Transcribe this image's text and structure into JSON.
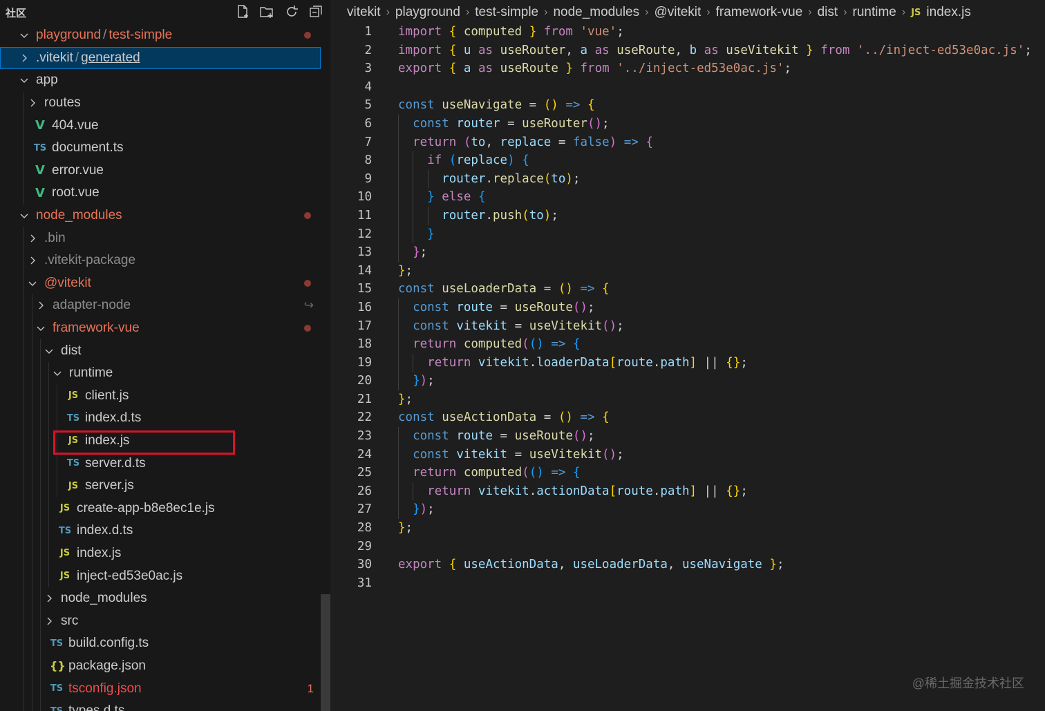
{
  "sidebar": {
    "title": "社区",
    "tree": [
      {
        "label": "playground",
        "label2": "test-simple",
        "kind": "folder",
        "open": true,
        "depth": 0,
        "color": "mod",
        "badge": "dot"
      },
      {
        "label": ".vitekit",
        "label2": "generated",
        "kind": "folder",
        "open": false,
        "depth": 0,
        "color": "normal",
        "selected": true
      },
      {
        "label": "app",
        "kind": "folder",
        "open": true,
        "depth": 0,
        "color": "normal"
      },
      {
        "label": "routes",
        "kind": "folder",
        "open": false,
        "depth": 1,
        "color": "normal"
      },
      {
        "label": "404.vue",
        "kind": "vue",
        "depth": 1,
        "color": "normal"
      },
      {
        "label": "document.ts",
        "kind": "ts",
        "depth": 1,
        "color": "normal"
      },
      {
        "label": "error.vue",
        "kind": "vue",
        "depth": 1,
        "color": "normal"
      },
      {
        "label": "root.vue",
        "kind": "vue",
        "depth": 1,
        "color": "normal"
      },
      {
        "label": "node_modules",
        "kind": "folder",
        "open": true,
        "depth": 0,
        "color": "mod",
        "badge": "dot"
      },
      {
        "label": ".bin",
        "kind": "folder",
        "open": false,
        "depth": 1,
        "color": "dim"
      },
      {
        "label": ".vitekit-package",
        "kind": "folder",
        "open": false,
        "depth": 1,
        "color": "dim"
      },
      {
        "label": "@vitekit",
        "kind": "folder",
        "open": true,
        "depth": 1,
        "color": "mod",
        "badge": "dot"
      },
      {
        "label": "adapter-node",
        "kind": "folder",
        "open": false,
        "depth": 2,
        "color": "dim",
        "badge": "link"
      },
      {
        "label": "framework-vue",
        "kind": "folder",
        "open": true,
        "depth": 2,
        "color": "mod",
        "badge": "dot"
      },
      {
        "label": "dist",
        "kind": "folder",
        "open": true,
        "depth": 3,
        "color": "normal"
      },
      {
        "label": "runtime",
        "kind": "folder",
        "open": true,
        "depth": 4,
        "color": "normal"
      },
      {
        "label": "client.js",
        "kind": "js",
        "depth": 5,
        "color": "normal"
      },
      {
        "label": "index.d.ts",
        "kind": "ts",
        "depth": 5,
        "color": "normal"
      },
      {
        "label": "index.js",
        "kind": "js",
        "depth": 5,
        "color": "normal",
        "highlighted": true
      },
      {
        "label": "server.d.ts",
        "kind": "ts",
        "depth": 5,
        "color": "normal"
      },
      {
        "label": "server.js",
        "kind": "js",
        "depth": 5,
        "color": "normal"
      },
      {
        "label": "create-app-b8e8ec1e.js",
        "kind": "js",
        "depth": 4,
        "color": "normal"
      },
      {
        "label": "index.d.ts",
        "kind": "ts",
        "depth": 4,
        "color": "normal"
      },
      {
        "label": "index.js",
        "kind": "js",
        "depth": 4,
        "color": "normal"
      },
      {
        "label": "inject-ed53e0ac.js",
        "kind": "js",
        "depth": 4,
        "color": "normal"
      },
      {
        "label": "node_modules",
        "kind": "folder",
        "open": false,
        "depth": 3,
        "color": "normal"
      },
      {
        "label": "src",
        "kind": "folder",
        "open": false,
        "depth": 3,
        "color": "normal"
      },
      {
        "label": "build.config.ts",
        "kind": "ts",
        "depth": 3,
        "color": "normal"
      },
      {
        "label": "package.json",
        "kind": "json",
        "depth": 3,
        "color": "normal"
      },
      {
        "label": "tsconfig.json",
        "kind": "tsconfig",
        "depth": 3,
        "color": "err",
        "badge": "1"
      },
      {
        "label": "types.d.ts",
        "kind": "ts",
        "depth": 3,
        "color": "normal"
      }
    ]
  },
  "breadcrumb": [
    "vitekit",
    "playground",
    "test-simple",
    "node_modules",
    "@vitekit",
    "framework-vue",
    "dist",
    "runtime",
    "index.js"
  ],
  "code": [
    {
      "n": "1",
      "tokens": [
        [
          "kc",
          "import"
        ],
        [
          "p",
          " "
        ],
        [
          "b1",
          "{"
        ],
        [
          "p",
          " "
        ],
        [
          "f",
          "computed"
        ],
        [
          "p",
          " "
        ],
        [
          "b1",
          "}"
        ],
        [
          "p",
          " "
        ],
        [
          "kc",
          "from"
        ],
        [
          "p",
          " "
        ],
        [
          "s",
          "'vue'"
        ],
        [
          "p",
          ";"
        ]
      ]
    },
    {
      "n": "2",
      "tokens": [
        [
          "kc",
          "import"
        ],
        [
          "p",
          " "
        ],
        [
          "b1",
          "{"
        ],
        [
          "p",
          " "
        ],
        [
          "v",
          "u"
        ],
        [
          "p",
          " "
        ],
        [
          "kc",
          "as"
        ],
        [
          "p",
          " "
        ],
        [
          "f",
          "useRouter"
        ],
        [
          "p",
          ", "
        ],
        [
          "v",
          "a"
        ],
        [
          "p",
          " "
        ],
        [
          "kc",
          "as"
        ],
        [
          "p",
          " "
        ],
        [
          "f",
          "useRoute"
        ],
        [
          "p",
          ", "
        ],
        [
          "v",
          "b"
        ],
        [
          "p",
          " "
        ],
        [
          "kc",
          "as"
        ],
        [
          "p",
          " "
        ],
        [
          "f",
          "useVitekit"
        ],
        [
          "p",
          " "
        ],
        [
          "b1",
          "}"
        ],
        [
          "p",
          " "
        ],
        [
          "kc",
          "from"
        ],
        [
          "p",
          " "
        ],
        [
          "s",
          "'../inject-ed53e0ac.js'"
        ],
        [
          "p",
          ";"
        ]
      ]
    },
    {
      "n": "3",
      "tokens": [
        [
          "kc",
          "export"
        ],
        [
          "p",
          " "
        ],
        [
          "b1",
          "{"
        ],
        [
          "p",
          " "
        ],
        [
          "v",
          "a"
        ],
        [
          "p",
          " "
        ],
        [
          "kc",
          "as"
        ],
        [
          "p",
          " "
        ],
        [
          "f",
          "useRoute"
        ],
        [
          "p",
          " "
        ],
        [
          "b1",
          "}"
        ],
        [
          "p",
          " "
        ],
        [
          "kc",
          "from"
        ],
        [
          "p",
          " "
        ],
        [
          "s",
          "'../inject-ed53e0ac.js'"
        ],
        [
          "p",
          ";"
        ]
      ]
    },
    {
      "n": "4",
      "tokens": []
    },
    {
      "n": "5",
      "tokens": [
        [
          "k",
          "const"
        ],
        [
          "p",
          " "
        ],
        [
          "f",
          "useNavigate"
        ],
        [
          "p",
          " = "
        ],
        [
          "b1",
          "()"
        ],
        [
          "p",
          " "
        ],
        [
          "k",
          "=>"
        ],
        [
          "p",
          " "
        ],
        [
          "b1",
          "{"
        ]
      ]
    },
    {
      "n": "6",
      "indent": 1,
      "tokens": [
        [
          "k",
          "const"
        ],
        [
          "p",
          " "
        ],
        [
          "v",
          "router"
        ],
        [
          "p",
          " = "
        ],
        [
          "f",
          "useRouter"
        ],
        [
          "b2",
          "()"
        ],
        [
          "p",
          ";"
        ]
      ]
    },
    {
      "n": "7",
      "indent": 1,
      "tokens": [
        [
          "kc",
          "return"
        ],
        [
          "p",
          " "
        ],
        [
          "b2",
          "("
        ],
        [
          "v",
          "to"
        ],
        [
          "p",
          ", "
        ],
        [
          "v",
          "replace"
        ],
        [
          "p",
          " = "
        ],
        [
          "k",
          "false"
        ],
        [
          "b2",
          ")"
        ],
        [
          "p",
          " "
        ],
        [
          "k",
          "=>"
        ],
        [
          "p",
          " "
        ],
        [
          "b2",
          "{"
        ]
      ]
    },
    {
      "n": "8",
      "indent": 2,
      "tokens": [
        [
          "kc",
          "if"
        ],
        [
          "p",
          " "
        ],
        [
          "b3",
          "("
        ],
        [
          "v",
          "replace"
        ],
        [
          "b3",
          ")"
        ],
        [
          "p",
          " "
        ],
        [
          "b3",
          "{"
        ]
      ]
    },
    {
      "n": "9",
      "indent": 3,
      "tokens": [
        [
          "v",
          "router"
        ],
        [
          "p",
          "."
        ],
        [
          "f",
          "replace"
        ],
        [
          "b1",
          "("
        ],
        [
          "v",
          "to"
        ],
        [
          "b1",
          ")"
        ],
        [
          "p",
          ";"
        ]
      ]
    },
    {
      "n": "10",
      "indent": 2,
      "tokens": [
        [
          "b3",
          "}"
        ],
        [
          "p",
          " "
        ],
        [
          "kc",
          "else"
        ],
        [
          "p",
          " "
        ],
        [
          "b3",
          "{"
        ]
      ]
    },
    {
      "n": "11",
      "indent": 3,
      "tokens": [
        [
          "v",
          "router"
        ],
        [
          "p",
          "."
        ],
        [
          "f",
          "push"
        ],
        [
          "b1",
          "("
        ],
        [
          "v",
          "to"
        ],
        [
          "b1",
          ")"
        ],
        [
          "p",
          ";"
        ]
      ]
    },
    {
      "n": "12",
      "indent": 2,
      "tokens": [
        [
          "b3",
          "}"
        ]
      ]
    },
    {
      "n": "13",
      "indent": 1,
      "tokens": [
        [
          "b2",
          "}"
        ],
        [
          "p",
          ";"
        ]
      ]
    },
    {
      "n": "14",
      "tokens": [
        [
          "b1",
          "}"
        ],
        [
          "p",
          ";"
        ]
      ]
    },
    {
      "n": "15",
      "tokens": [
        [
          "k",
          "const"
        ],
        [
          "p",
          " "
        ],
        [
          "f",
          "useLoaderData"
        ],
        [
          "p",
          " = "
        ],
        [
          "b1",
          "()"
        ],
        [
          "p",
          " "
        ],
        [
          "k",
          "=>"
        ],
        [
          "p",
          " "
        ],
        [
          "b1",
          "{"
        ]
      ]
    },
    {
      "n": "16",
      "indent": 1,
      "tokens": [
        [
          "k",
          "const"
        ],
        [
          "p",
          " "
        ],
        [
          "v",
          "route"
        ],
        [
          "p",
          " = "
        ],
        [
          "f",
          "useRoute"
        ],
        [
          "b2",
          "()"
        ],
        [
          "p",
          ";"
        ]
      ]
    },
    {
      "n": "17",
      "indent": 1,
      "tokens": [
        [
          "k",
          "const"
        ],
        [
          "p",
          " "
        ],
        [
          "v",
          "vitekit"
        ],
        [
          "p",
          " = "
        ],
        [
          "f",
          "useVitekit"
        ],
        [
          "b2",
          "()"
        ],
        [
          "p",
          ";"
        ]
      ]
    },
    {
      "n": "18",
      "indent": 1,
      "tokens": [
        [
          "kc",
          "return"
        ],
        [
          "p",
          " "
        ],
        [
          "f",
          "computed"
        ],
        [
          "b2",
          "("
        ],
        [
          "b3",
          "()"
        ],
        [
          "p",
          " "
        ],
        [
          "k",
          "=>"
        ],
        [
          "p",
          " "
        ],
        [
          "b3",
          "{"
        ]
      ]
    },
    {
      "n": "19",
      "indent": 2,
      "tokens": [
        [
          "kc",
          "return"
        ],
        [
          "p",
          " "
        ],
        [
          "v",
          "vitekit"
        ],
        [
          "p",
          "."
        ],
        [
          "v",
          "loaderData"
        ],
        [
          "b1",
          "["
        ],
        [
          "v",
          "route"
        ],
        [
          "p",
          "."
        ],
        [
          "v",
          "path"
        ],
        [
          "b1",
          "]"
        ],
        [
          "p",
          " || "
        ],
        [
          "b1",
          "{}"
        ],
        [
          "p",
          ";"
        ]
      ]
    },
    {
      "n": "20",
      "indent": 1,
      "tokens": [
        [
          "b3",
          "}"
        ],
        [
          "b2",
          ")"
        ],
        [
          "p",
          ";"
        ]
      ]
    },
    {
      "n": "21",
      "tokens": [
        [
          "b1",
          "}"
        ],
        [
          "p",
          ";"
        ]
      ]
    },
    {
      "n": "22",
      "tokens": [
        [
          "k",
          "const"
        ],
        [
          "p",
          " "
        ],
        [
          "f",
          "useActionData"
        ],
        [
          "p",
          " = "
        ],
        [
          "b1",
          "()"
        ],
        [
          "p",
          " "
        ],
        [
          "k",
          "=>"
        ],
        [
          "p",
          " "
        ],
        [
          "b1",
          "{"
        ]
      ]
    },
    {
      "n": "23",
      "indent": 1,
      "tokens": [
        [
          "k",
          "const"
        ],
        [
          "p",
          " "
        ],
        [
          "v",
          "route"
        ],
        [
          "p",
          " = "
        ],
        [
          "f",
          "useRoute"
        ],
        [
          "b2",
          "()"
        ],
        [
          "p",
          ";"
        ]
      ]
    },
    {
      "n": "24",
      "indent": 1,
      "tokens": [
        [
          "k",
          "const"
        ],
        [
          "p",
          " "
        ],
        [
          "v",
          "vitekit"
        ],
        [
          "p",
          " = "
        ],
        [
          "f",
          "useVitekit"
        ],
        [
          "b2",
          "()"
        ],
        [
          "p",
          ";"
        ]
      ]
    },
    {
      "n": "25",
      "indent": 1,
      "tokens": [
        [
          "kc",
          "return"
        ],
        [
          "p",
          " "
        ],
        [
          "f",
          "computed"
        ],
        [
          "b2",
          "("
        ],
        [
          "b3",
          "()"
        ],
        [
          "p",
          " "
        ],
        [
          "k",
          "=>"
        ],
        [
          "p",
          " "
        ],
        [
          "b3",
          "{"
        ]
      ]
    },
    {
      "n": "26",
      "indent": 2,
      "tokens": [
        [
          "kc",
          "return"
        ],
        [
          "p",
          " "
        ],
        [
          "v",
          "vitekit"
        ],
        [
          "p",
          "."
        ],
        [
          "v",
          "actionData"
        ],
        [
          "b1",
          "["
        ],
        [
          "v",
          "route"
        ],
        [
          "p",
          "."
        ],
        [
          "v",
          "path"
        ],
        [
          "b1",
          "]"
        ],
        [
          "p",
          " || "
        ],
        [
          "b1",
          "{}"
        ],
        [
          "p",
          ";"
        ]
      ]
    },
    {
      "n": "27",
      "indent": 1,
      "tokens": [
        [
          "b3",
          "}"
        ],
        [
          "b2",
          ")"
        ],
        [
          "p",
          ";"
        ]
      ]
    },
    {
      "n": "28",
      "tokens": [
        [
          "b1",
          "}"
        ],
        [
          "p",
          ";"
        ]
      ]
    },
    {
      "n": "29",
      "tokens": []
    },
    {
      "n": "30",
      "tokens": [
        [
          "kc",
          "export"
        ],
        [
          "p",
          " "
        ],
        [
          "b1",
          "{"
        ],
        [
          "p",
          " "
        ],
        [
          "v",
          "useActionData"
        ],
        [
          "p",
          ", "
        ],
        [
          "v",
          "useLoaderData"
        ],
        [
          "p",
          ", "
        ],
        [
          "v",
          "useNavigate"
        ],
        [
          "p",
          " "
        ],
        [
          "b1",
          "}"
        ],
        [
          "p",
          ";"
        ]
      ]
    },
    {
      "n": "31",
      "tokens": []
    }
  ],
  "watermark": "@稀土掘金技术社区",
  "icons": {
    "new_file": "new-file-icon",
    "new_folder": "new-folder-icon",
    "refresh": "refresh-icon",
    "collapse": "collapse-all-icon"
  }
}
